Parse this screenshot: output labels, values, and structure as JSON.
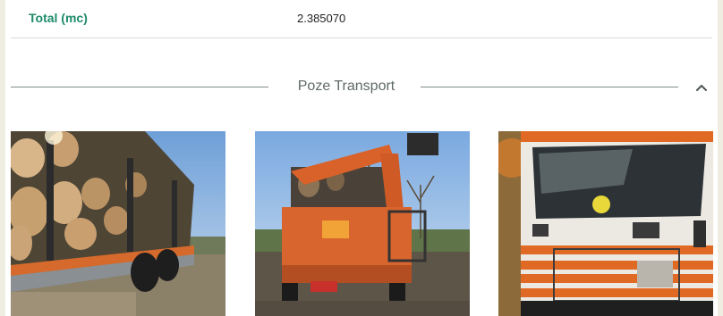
{
  "summary": {
    "total_label": "Total (mc)",
    "total_value": "2.385070"
  },
  "transport_section": {
    "title": "Poze Transport",
    "collapse_icon": "chevron-up-icon",
    "photos": [
      {
        "name": "log-truck-side-photo"
      },
      {
        "name": "log-truck-crane-rear-photo"
      },
      {
        "name": "orange-truck-cab-front-photo"
      }
    ]
  },
  "colors": {
    "accent_green": "#1e8b6b",
    "divider": "#7f8d88",
    "page_bg": "#efede2"
  }
}
